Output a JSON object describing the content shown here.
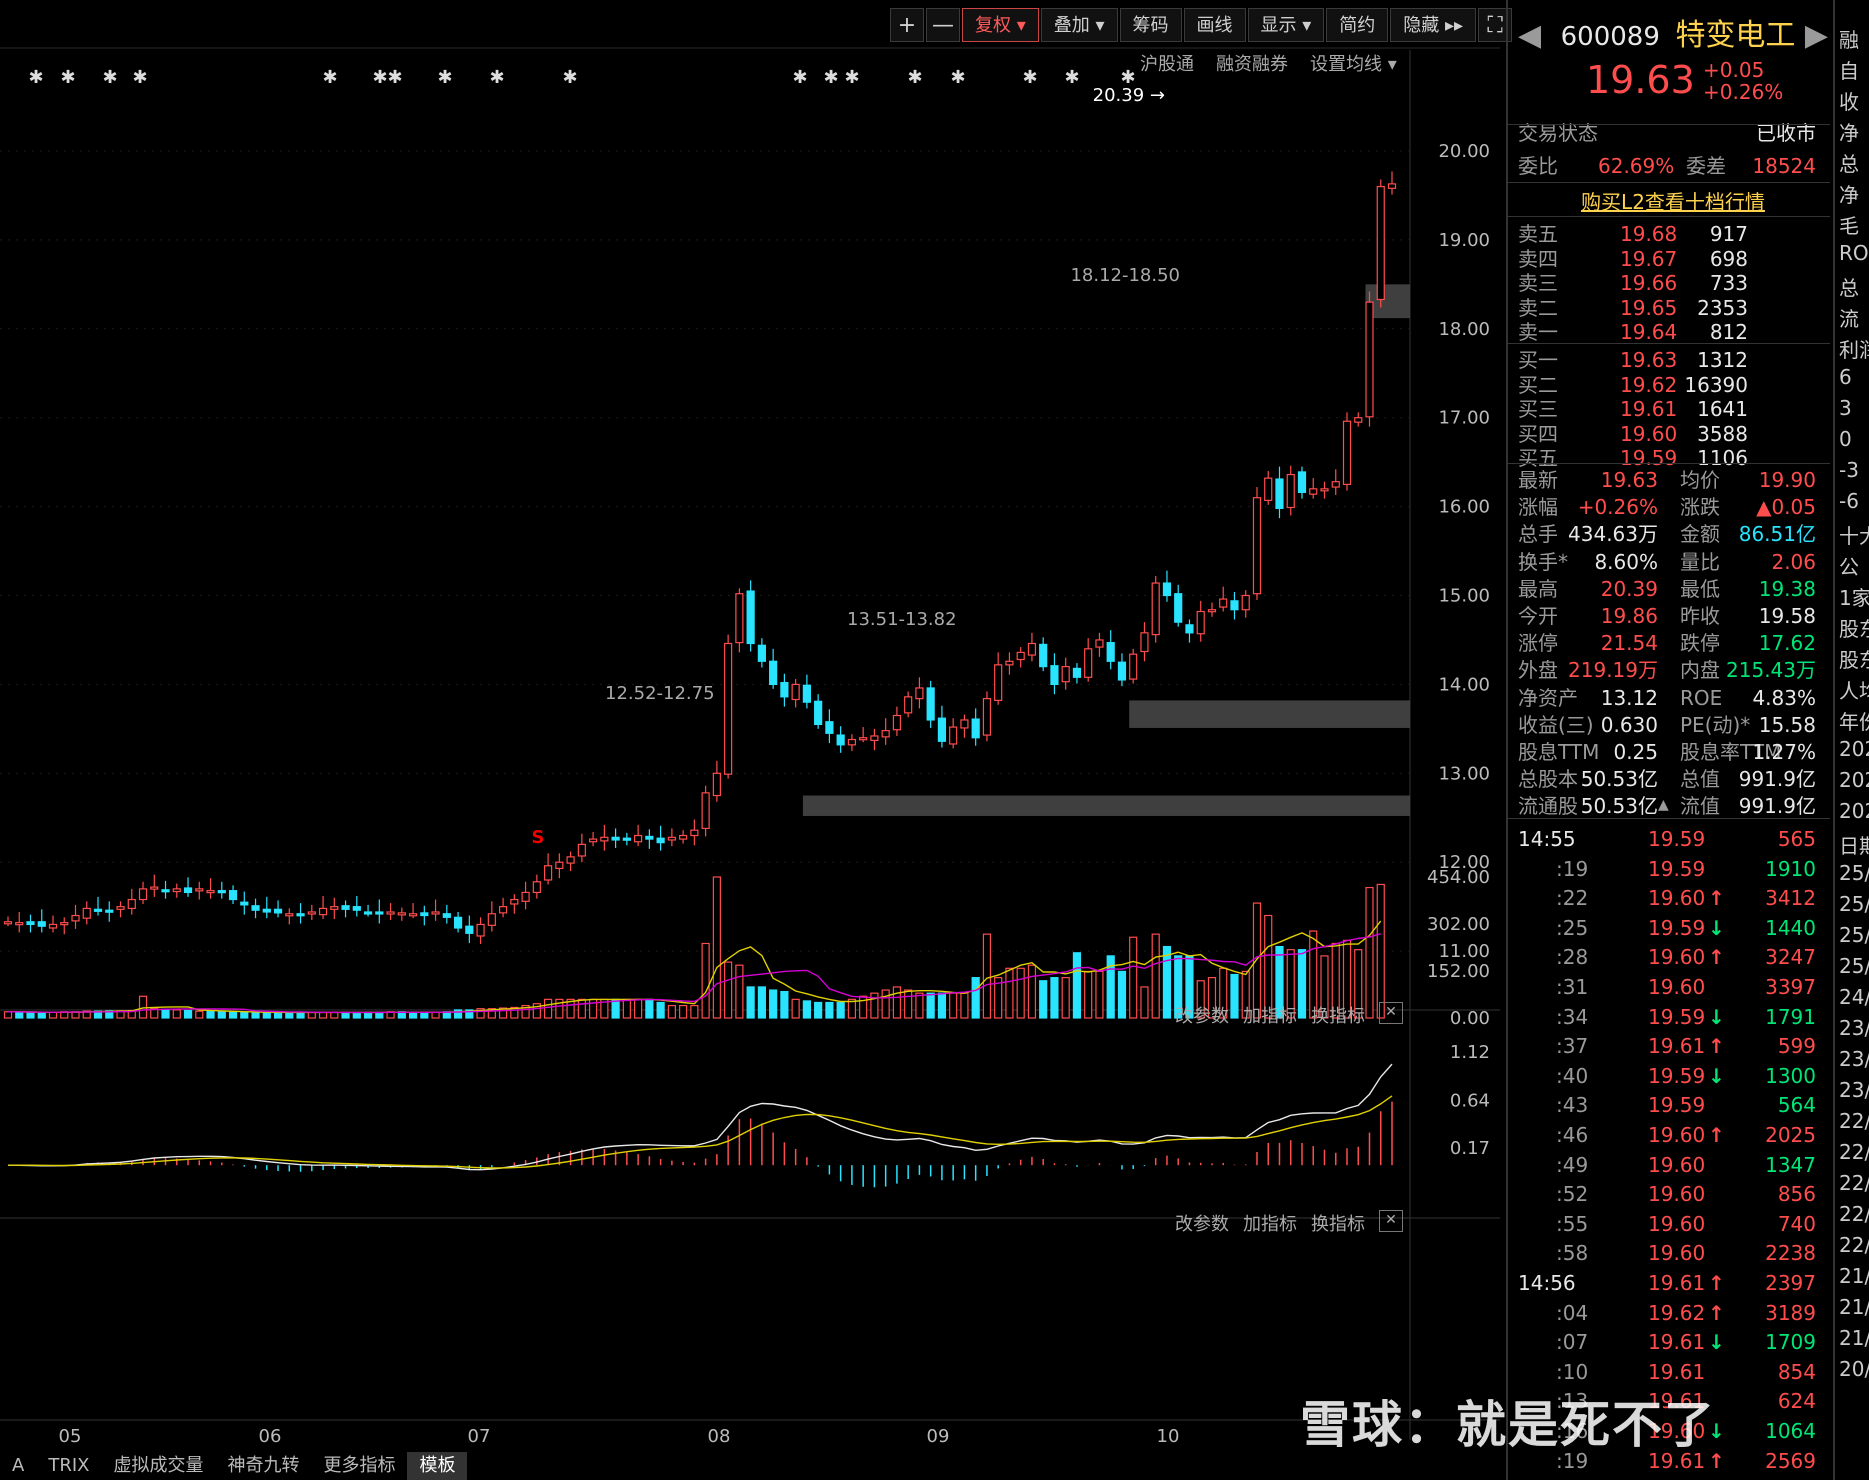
{
  "toolbar": {
    "plus": "+",
    "minus": "—",
    "fuquan": "复权",
    "diejia": "叠加",
    "chouma": "筹码",
    "huaxian": "画线",
    "xianshi": "显示",
    "jianyue": "简约",
    "yincang": "隐藏",
    "fullscreen": "⛶"
  },
  "subbar": {
    "hugutong": "沪股通",
    "rongzi": "融资融券",
    "shezhi": "设置均线"
  },
  "panel_tools": {
    "gai": "改参数",
    "jia": "加指标",
    "huan": "换指标"
  },
  "chart_data": [
    {
      "type": "candlestick",
      "title": "",
      "ylim": [
        10.5,
        21
      ],
      "yticks": [
        "20.00",
        "19.00",
        "18.00",
        "17.00",
        "16.00",
        "15.00",
        "14.00",
        "13.00",
        "12.00",
        "11.00"
      ],
      "xlabels": [
        "05",
        "06",
        "07",
        "08",
        "09",
        "10"
      ],
      "annotations": {
        "high": "20.39",
        "zone1": "18.12-18.50",
        "zone2": "13.51-13.82",
        "zone3": "12.52-12.75",
        "marker": "S"
      },
      "closes": [
        11.33,
        11.32,
        11.3,
        11.28,
        11.3,
        11.32,
        11.4,
        11.48,
        11.45,
        11.44,
        11.5,
        11.58,
        11.7,
        11.72,
        11.68,
        11.7,
        11.66,
        11.7,
        11.68,
        11.66,
        11.58,
        11.52,
        11.46,
        11.44,
        11.43,
        11.42,
        11.4,
        11.44,
        11.48,
        11.5,
        11.47,
        11.46,
        11.44,
        11.42,
        11.44,
        11.43,
        11.42,
        11.4,
        11.44,
        11.38,
        11.26,
        11.2,
        11.3,
        11.42,
        11.5,
        11.58,
        11.66,
        11.78,
        11.96,
        12.0,
        12.06,
        12.2,
        12.26,
        12.28,
        12.25,
        12.26,
        12.3,
        12.26,
        12.22,
        12.28,
        12.3,
        12.36,
        12.78,
        13.0,
        14.46,
        15.02,
        14.46,
        14.26,
        14.0,
        13.86,
        14.0,
        13.8,
        13.55,
        13.45,
        13.32,
        13.38,
        13.4,
        13.42,
        13.48,
        13.65,
        13.86,
        13.96,
        13.6,
        13.36,
        13.52,
        13.6,
        13.4,
        13.84,
        14.22,
        14.26,
        14.36,
        14.46,
        14.2,
        14.0,
        14.2,
        14.08,
        14.4,
        14.5,
        14.26,
        14.05,
        14.34,
        14.58,
        15.14,
        15.0,
        14.7,
        14.58,
        14.82,
        14.84,
        14.96,
        14.84,
        15.0,
        16.1,
        16.32,
        15.98,
        16.36,
        16.16,
        16.2,
        16.2,
        16.28,
        16.96,
        17.0,
        18.3,
        19.6,
        19.63
      ],
      "ohlc_note": "estimated",
      "volume_ticks": [
        "454.00",
        "302.00",
        "152.00",
        "0.00"
      ],
      "volumes": [
        20,
        20,
        18,
        17,
        18,
        20,
        20,
        22,
        22,
        23,
        23,
        24,
        70,
        30,
        28,
        26,
        24,
        22,
        22,
        20,
        20,
        18,
        18,
        18,
        18,
        18,
        18,
        18,
        18,
        18,
        18,
        18,
        18,
        18,
        20,
        20,
        18,
        18,
        18,
        20,
        26,
        26,
        30,
        30,
        32,
        34,
        40,
        46,
        60,
        60,
        60,
        60,
        60,
        60,
        60,
        60,
        60,
        60,
        50,
        40,
        40,
        40,
        240,
        454,
        180,
        170,
        100,
        100,
        90,
        85,
        60,
        55,
        50,
        50,
        50,
        60,
        70,
        80,
        90,
        100,
        90,
        80,
        80,
        80,
        80,
        80,
        130,
        270,
        130,
        160,
        160,
        170,
        120,
        130,
        130,
        210,
        150,
        150,
        200,
        150,
        260,
        100,
        270,
        230,
        200,
        200,
        120,
        130,
        160,
        140,
        150,
        370,
        330,
        230,
        220,
        220,
        280,
        200,
        240,
        250,
        220,
        420,
        430
      ],
      "macd_ticks": [
        "1.12",
        "0.64",
        "0.17"
      ]
    }
  ],
  "quote": {
    "code": "600089",
    "name": "特变电工",
    "price": "19.63",
    "change": "+0.05",
    "pct": "+0.26%",
    "status_label": "交易状态",
    "status": "已收市",
    "weibi_label": "委比",
    "weibi": "62.69%",
    "weicha_label": "委差",
    "weicha": "18524",
    "l2": "购买L2查看十档行情",
    "asks": [
      {
        "label": "卖五",
        "price": "19.68",
        "vol": "917"
      },
      {
        "label": "卖四",
        "price": "19.67",
        "vol": "698"
      },
      {
        "label": "卖三",
        "price": "19.66",
        "vol": "733"
      },
      {
        "label": "卖二",
        "price": "19.65",
        "vol": "2353"
      },
      {
        "label": "卖一",
        "price": "19.64",
        "vol": "812"
      }
    ],
    "bids": [
      {
        "label": "买一",
        "price": "19.63",
        "vol": "1312"
      },
      {
        "label": "买二",
        "price": "19.62",
        "vol": "16390"
      },
      {
        "label": "买三",
        "price": "19.61",
        "vol": "1641"
      },
      {
        "label": "买四",
        "price": "19.60",
        "vol": "3588"
      },
      {
        "label": "买五",
        "price": "19.59",
        "vol": "1106"
      }
    ],
    "stats": [
      {
        "l1": "最新",
        "v1": "19.63",
        "c1": "red",
        "l2": "均价",
        "v2": "19.90",
        "c2": "red"
      },
      {
        "l1": "涨幅",
        "v1": "+0.26%",
        "c1": "red",
        "l2": "涨跌",
        "v2": "▲0.05",
        "c2": "red"
      },
      {
        "l1": "总手",
        "v1": "434.63万",
        "c1": "white",
        "l2": "金额",
        "v2": "86.51亿",
        "c2": "cyan"
      },
      {
        "l1": "换手*",
        "v1": "8.60%",
        "c1": "white",
        "l2": "量比",
        "v2": "2.06",
        "c2": "red"
      },
      {
        "l1": "最高",
        "v1": "20.39",
        "c1": "red",
        "l2": "最低",
        "v2": "19.38",
        "c2": "green"
      },
      {
        "l1": "今开",
        "v1": "19.86",
        "c1": "red",
        "l2": "昨收",
        "v2": "19.58",
        "c2": "white"
      },
      {
        "l1": "涨停",
        "v1": "21.54",
        "c1": "red",
        "l2": "跌停",
        "v2": "17.62",
        "c2": "green"
      },
      {
        "l1": "外盘",
        "v1": "219.19万",
        "c1": "red",
        "l2": "内盘",
        "v2": "215.43万",
        "c2": "green"
      },
      {
        "l1": "净资产",
        "v1": "13.12",
        "c1": "white",
        "l2": "ROE",
        "v2": "4.83%",
        "c2": "white"
      },
      {
        "l1": "收益(三)",
        "v1": "0.630",
        "c1": "white",
        "l2": "PE(动)*",
        "v2": "15.58",
        "c2": "white"
      },
      {
        "l1": "股息TTM",
        "v1": "0.25",
        "c1": "white",
        "l2": "股息率TTM",
        "v2": "1.27%",
        "c2": "white"
      },
      {
        "l1": "总股本",
        "v1": "50.53亿",
        "c1": "white",
        "l2": "总值",
        "v2": "991.9亿",
        "c2": "white"
      },
      {
        "l1": "流通股",
        "v1": "50.53亿",
        "c1": "white",
        "l2": "流值",
        "v2": "991.9亿",
        "c2": "white"
      }
    ],
    "ticks": [
      {
        "t": "14:55",
        "p": "19.59",
        "a": "",
        "v": "565",
        "vc": "red"
      },
      {
        "t": ":19",
        "p": "19.59",
        "a": "",
        "v": "1910",
        "vc": "green"
      },
      {
        "t": ":22",
        "p": "19.60",
        "a": "↑",
        "v": "3412",
        "vc": "red"
      },
      {
        "t": ":25",
        "p": "19.59",
        "a": "↓",
        "v": "1440",
        "vc": "green"
      },
      {
        "t": ":28",
        "p": "19.60",
        "a": "↑",
        "v": "3247",
        "vc": "red"
      },
      {
        "t": ":31",
        "p": "19.60",
        "a": "",
        "v": "3397",
        "vc": "red"
      },
      {
        "t": ":34",
        "p": "19.59",
        "a": "↓",
        "v": "1791",
        "vc": "green"
      },
      {
        "t": ":37",
        "p": "19.61",
        "a": "↑",
        "v": "599",
        "vc": "red"
      },
      {
        "t": ":40",
        "p": "19.59",
        "a": "↓",
        "v": "1300",
        "vc": "green"
      },
      {
        "t": ":43",
        "p": "19.59",
        "a": "",
        "v": "564",
        "vc": "green"
      },
      {
        "t": ":46",
        "p": "19.60",
        "a": "↑",
        "v": "2025",
        "vc": "red"
      },
      {
        "t": ":49",
        "p": "19.60",
        "a": "",
        "v": "1347",
        "vc": "green"
      },
      {
        "t": ":52",
        "p": "19.60",
        "a": "",
        "v": "856",
        "vc": "red"
      },
      {
        "t": ":55",
        "p": "19.60",
        "a": "",
        "v": "740",
        "vc": "red"
      },
      {
        "t": ":58",
        "p": "19.60",
        "a": "",
        "v": "2238",
        "vc": "red"
      },
      {
        "t": "14:56",
        "p": "19.61",
        "a": "↑",
        "v": "2397",
        "vc": "red"
      },
      {
        "t": ":04",
        "p": "19.62",
        "a": "↑",
        "v": "3189",
        "vc": "red"
      },
      {
        "t": ":07",
        "p": "19.61",
        "a": "↓",
        "v": "1709",
        "vc": "green"
      },
      {
        "t": ":10",
        "p": "19.61",
        "a": "",
        "v": "854",
        "vc": "red"
      },
      {
        "t": ":13",
        "p": "19.61",
        "a": "",
        "v": "624",
        "vc": "red"
      },
      {
        "t": ":16",
        "p": "19.60",
        "a": "↓",
        "v": "1064",
        "vc": "green"
      },
      {
        "t": ":19",
        "p": "19.61",
        "a": "↑",
        "v": "2569",
        "vc": "red"
      }
    ]
  },
  "far_right": [
    "融",
    "自",
    "收",
    "净",
    "总",
    "净",
    "毛",
    "RO",
    "总",
    "流",
    "利润",
    "6",
    "3",
    "0",
    "-3",
    "-6",
    "十大",
    "公",
    "1家",
    "股东",
    "股东",
    "人均",
    "年份",
    "202",
    "202",
    "202",
    "日期",
    "25/",
    "25/",
    "25/",
    "25/",
    "24/",
    "23/",
    "23/",
    "23/",
    "22/",
    "22/",
    "22/",
    "22/",
    "22/",
    "21/",
    "21/",
    "21/",
    "20/"
  ],
  "bottom_tabs": [
    "A",
    "TRIX",
    "虚拟成交量",
    "神奇九转",
    "更多指标",
    "模板"
  ],
  "watermark": "雪球：就是死不了",
  "colors": {
    "up": "#ff4d4d",
    "down": "#29e3ff",
    "ma1": "#e8e8e8",
    "ma2": "#e0d000",
    "ma3": "#d400d4"
  }
}
